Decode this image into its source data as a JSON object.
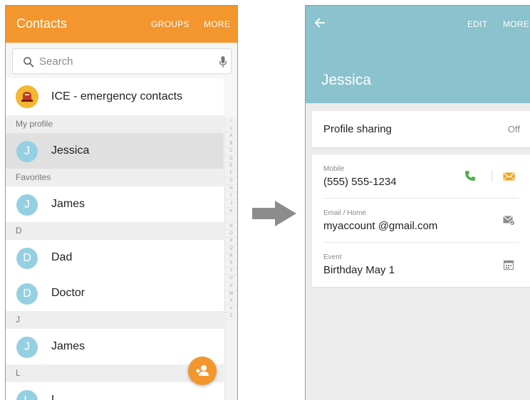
{
  "left_screen": {
    "title": "Contacts",
    "actions": {
      "groups": "GROUPS",
      "more": "MORE"
    },
    "search_placeholder": "Search",
    "ice_label": "ICE - emergency contacts",
    "sections": {
      "my_profile": "My profile",
      "favorites": "Favorites",
      "d": "D",
      "j": "J",
      "l": "L"
    },
    "contacts": {
      "profile": {
        "initial": "J",
        "name": "Jessica"
      },
      "favorite_1": {
        "initial": "J",
        "name": "James"
      },
      "d_1": {
        "initial": "D",
        "name": "Dad"
      },
      "d_2": {
        "initial": "D",
        "name": "Doctor"
      },
      "j_1": {
        "initial": "J",
        "name": "James"
      },
      "l_1": {
        "initial": "L",
        "name": "L"
      }
    },
    "index_letters": [
      "☆",
      "#",
      "A",
      "B",
      "C",
      "D",
      "E",
      "F",
      "G",
      "H",
      "I",
      "J",
      "K",
      "·",
      "N",
      "O",
      "P",
      "Q",
      "R",
      "S",
      "T",
      "U",
      "V",
      "W",
      "X",
      "Y",
      "Z"
    ],
    "fab_icon": "add-contact-icon"
  },
  "right_screen": {
    "actions": {
      "edit": "EDIT",
      "more": "MORE"
    },
    "contact_name": "Jessica",
    "profile_sharing": {
      "label": "Profile sharing",
      "value": "Off"
    },
    "details": {
      "mobile": {
        "label": "Mobile",
        "value": "(555) 555-1234"
      },
      "email": {
        "label": "Email / Home",
        "value": "myaccount @gmail.com"
      },
      "event": {
        "label": "Event",
        "value": "Birthday May 1"
      }
    }
  },
  "colors": {
    "contacts_bar": "#f2962d",
    "details_header": "#8ac2cd",
    "avatar": "#95d0e2",
    "call_green": "#4caf50",
    "message_orange": "#f2a21b"
  }
}
